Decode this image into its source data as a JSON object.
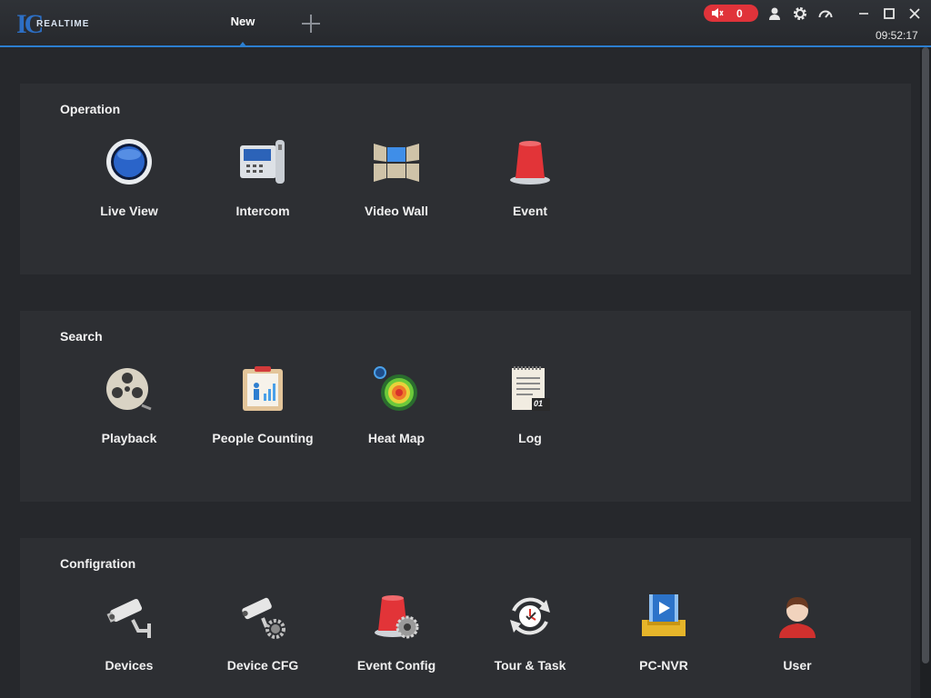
{
  "app": {
    "logo_text": "REALTIME",
    "clock": "09:52:17"
  },
  "tabs": [
    {
      "label": "New"
    }
  ],
  "alarm": {
    "count": "0"
  },
  "colors": {
    "accent": "#2c7fd0",
    "alarm": "#e0333a",
    "panel": "#2d2f33",
    "background": "#26282c"
  },
  "sections": [
    {
      "title": "Operation",
      "items": [
        {
          "label": "Live View",
          "icon": "live-view-icon"
        },
        {
          "label": "Intercom",
          "icon": "intercom-icon"
        },
        {
          "label": "Video Wall",
          "icon": "video-wall-icon"
        },
        {
          "label": "Event",
          "icon": "event-icon"
        }
      ]
    },
    {
      "title": "Search",
      "items": [
        {
          "label": "Playback",
          "icon": "playback-icon"
        },
        {
          "label": "People Counting",
          "icon": "people-counting-icon"
        },
        {
          "label": "Heat Map",
          "icon": "heat-map-icon"
        },
        {
          "label": "Log",
          "icon": "log-icon",
          "badge": "01"
        }
      ]
    },
    {
      "title": "Configration",
      "items": [
        {
          "label": "Devices",
          "icon": "devices-icon"
        },
        {
          "label": "Device CFG",
          "icon": "device-cfg-icon"
        },
        {
          "label": "Event Config",
          "icon": "event-config-icon"
        },
        {
          "label": "Tour & Task",
          "icon": "tour-task-icon"
        },
        {
          "label": "PC-NVR",
          "icon": "pc-nvr-icon"
        },
        {
          "label": "User",
          "icon": "user-icon"
        }
      ]
    }
  ]
}
